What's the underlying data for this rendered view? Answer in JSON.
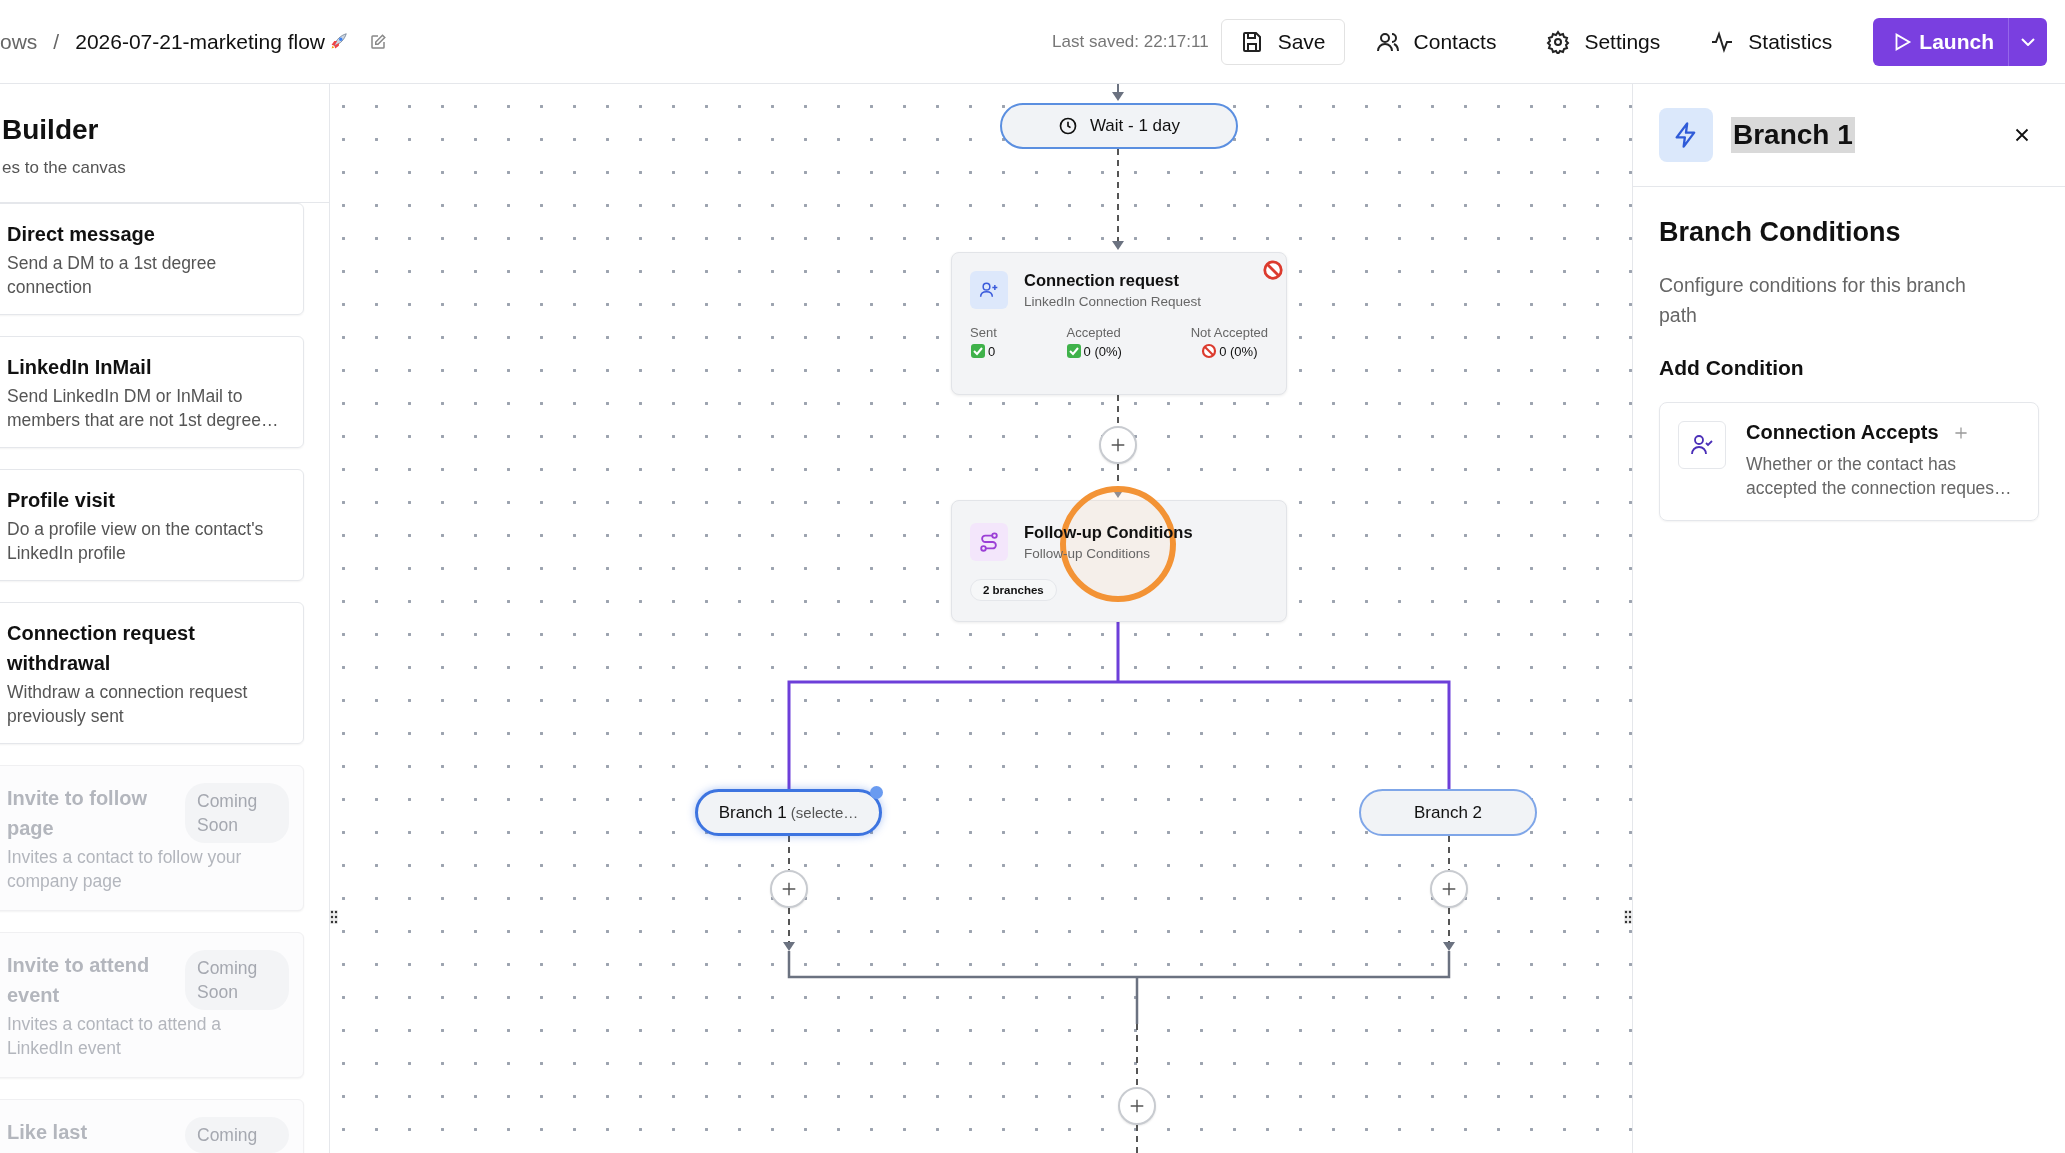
{
  "breadcrumb": {
    "parent": "ows",
    "separator": "/",
    "title": "2026-07-21-marketing flow"
  },
  "toolbar": {
    "last_saved": "Last saved: 22:17:11",
    "buttons": [
      {
        "label": "Save",
        "kind": "save"
      },
      {
        "label": "Contacts",
        "kind": "contacts"
      },
      {
        "label": "Settings",
        "kind": "settings"
      },
      {
        "label": "Statistics",
        "kind": "statistics"
      }
    ],
    "launch": "Launch"
  },
  "sidebar": {
    "title": "Builder",
    "subtitle": "es to the canvas",
    "items": [
      {
        "title": "Direct message",
        "description": "Send a DM to a 1st degree connection",
        "disabled": false
      },
      {
        "title": "LinkedIn InMail",
        "description": "Send LinkedIn DM or InMail to members that are not 1st degree…",
        "disabled": false
      },
      {
        "title": "Profile visit",
        "description": "Do a profile view on the contact's LinkedIn profile",
        "disabled": false
      },
      {
        "title": "Connection request withdrawal",
        "description": "Withdraw a connection request previously sent",
        "disabled": false
      },
      {
        "title": "Invite to follow page",
        "description": "Invites a contact to follow your company page",
        "disabled": true,
        "badge": "Coming Soon"
      },
      {
        "title": "Invite to attend event",
        "description": "Invites a contact to attend a LinkedIn event",
        "disabled": true,
        "badge": "Coming Soon"
      },
      {
        "title": "Like last",
        "disabled": true,
        "badge": "Coming"
      }
    ]
  },
  "canvas": {
    "wait_node": {
      "label": "Wait - 1 day"
    },
    "action_node": {
      "title": "Connection request",
      "subtitle": "LinkedIn Connection Request",
      "error": true,
      "stats": [
        {
          "label": "Sent",
          "value": "0",
          "kind": "success"
        },
        {
          "label": "Accepted",
          "value": "0 (0%)",
          "kind": "success"
        },
        {
          "label": "Not Accepted",
          "value": "0 (0%)",
          "kind": "failure"
        }
      ]
    },
    "condition_node": {
      "title": "Follow-up Conditions",
      "subtitle": "Follow-up Conditions",
      "badge": "2 branches"
    },
    "branches": [
      {
        "label": "Branch 1",
        "note": "(selecte…",
        "selected": true
      },
      {
        "label": "Branch 2",
        "selected": false
      }
    ],
    "click_highlight": true
  },
  "panel": {
    "title": "Branch 1",
    "title_selected": true,
    "heading": "Branch Conditions",
    "description": "Configure conditions for this branch path",
    "section": "Add Condition",
    "conditions": [
      {
        "title": "Connection Accepts",
        "description": "Whether or the contact has accepted the connection reques…"
      }
    ]
  }
}
